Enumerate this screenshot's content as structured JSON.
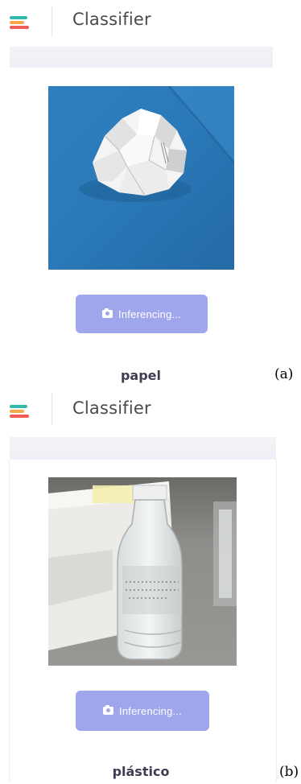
{
  "panels": [
    {
      "app_title": "Classifier",
      "logo_icon": "stacked-bars-logo-icon",
      "image_subject": "crumpled-paper-on-blue-surface",
      "button_label": "Inferencing...",
      "button_icon": "camera-icon",
      "prediction": "papel",
      "subfigure_label": "(a)"
    },
    {
      "app_title": "Classifier",
      "logo_icon": "stacked-bars-logo-icon",
      "image_subject": "plastic-water-bottle-on-desk",
      "button_label": "Inferencing...",
      "button_icon": "camera-icon",
      "prediction": "plástico",
      "subfigure_label": "(b)"
    }
  ],
  "colors": {
    "button_bg": "#a0a6ec",
    "logo_teal": "#33b8b0",
    "logo_orange": "#f3a84a",
    "logo_red": "#ef5b55",
    "label_text": "#3e3e52"
  }
}
